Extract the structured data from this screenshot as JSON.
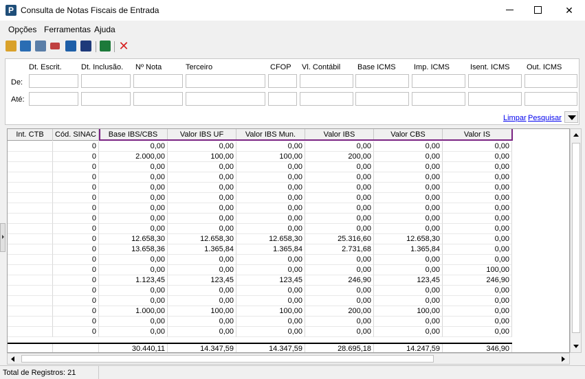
{
  "window": {
    "title": "Consulta de Notas Fiscais de Entrada",
    "app_icon_letter": "P",
    "close_glyph": "✕"
  },
  "menu": [
    "Opções",
    "Ferramentas",
    "Ajuda"
  ],
  "toolbar": {
    "icons": [
      "book-icon",
      "layers-icon",
      "form-icon",
      "eraser-icon",
      "save-icon",
      "chart-icon",
      "excel-icon",
      "close-icon"
    ],
    "colors": {
      "book": "#d9a12a",
      "layers": "#2a6db3",
      "form": "#5a7ea8",
      "eraser": "#c04040",
      "save": "#1e5fa8",
      "chart": "#1e3a7a",
      "excel": "#1d7a3a",
      "close": "#d62020"
    },
    "close_glyph": "✕"
  },
  "filter": {
    "columns": [
      "Dt. Escrit.",
      "Dt. Inclusão.",
      "Nº Nota",
      "Terceiro",
      "CFOP",
      "Vl. Contábil",
      "Base ICMS",
      "Imp. ICMS",
      "Isent. ICMS",
      "Out. ICMS"
    ],
    "row_labels": [
      "De:",
      "Até:"
    ],
    "links": {
      "clear": "Limpar",
      "search": "Pesquisar"
    }
  },
  "grid": {
    "headers": [
      "Int. CTB",
      "Cód. SINAC",
      "Base IBS/CBS",
      "Valor IBS UF",
      "Valor IBS Mun.",
      "Valor IBS",
      "Valor CBS",
      "Valor IS"
    ],
    "rows": [
      [
        "",
        "0",
        "0,00",
        "0,00",
        "0,00",
        "0,00",
        "0,00",
        "0,00"
      ],
      [
        "",
        "0",
        "2.000,00",
        "100,00",
        "100,00",
        "200,00",
        "0,00",
        "0,00"
      ],
      [
        "",
        "0",
        "0,00",
        "0,00",
        "0,00",
        "0,00",
        "0,00",
        "0,00"
      ],
      [
        "",
        "0",
        "0,00",
        "0,00",
        "0,00",
        "0,00",
        "0,00",
        "0,00"
      ],
      [
        "",
        "0",
        "0,00",
        "0,00",
        "0,00",
        "0,00",
        "0,00",
        "0,00"
      ],
      [
        "",
        "0",
        "0,00",
        "0,00",
        "0,00",
        "0,00",
        "0,00",
        "0,00"
      ],
      [
        "",
        "0",
        "0,00",
        "0,00",
        "0,00",
        "0,00",
        "0,00",
        "0,00"
      ],
      [
        "",
        "0",
        "0,00",
        "0,00",
        "0,00",
        "0,00",
        "0,00",
        "0,00"
      ],
      [
        "",
        "0",
        "0,00",
        "0,00",
        "0,00",
        "0,00",
        "0,00",
        "0,00"
      ],
      [
        "",
        "0",
        "12.658,30",
        "12.658,30",
        "12.658,30",
        "25.316,60",
        "12.658,30",
        "0,00"
      ],
      [
        "",
        "0",
        "13.658,36",
        "1.365,84",
        "1.365,84",
        "2.731,68",
        "1.365,84",
        "0,00"
      ],
      [
        "",
        "0",
        "0,00",
        "0,00",
        "0,00",
        "0,00",
        "0,00",
        "0,00"
      ],
      [
        "",
        "0",
        "0,00",
        "0,00",
        "0,00",
        "0,00",
        "0,00",
        "100,00"
      ],
      [
        "",
        "0",
        "1.123,45",
        "123,45",
        "123,45",
        "246,90",
        "123,45",
        "246,90"
      ],
      [
        "",
        "0",
        "0,00",
        "0,00",
        "0,00",
        "0,00",
        "0,00",
        "0,00"
      ],
      [
        "",
        "0",
        "0,00",
        "0,00",
        "0,00",
        "0,00",
        "0,00",
        "0,00"
      ],
      [
        "",
        "0",
        "1.000,00",
        "100,00",
        "100,00",
        "200,00",
        "100,00",
        "0,00"
      ],
      [
        "",
        "0",
        "0,00",
        "0,00",
        "0,00",
        "0,00",
        "0,00",
        "0,00"
      ],
      [
        "",
        "0",
        "0,00",
        "0,00",
        "0,00",
        "0,00",
        "0,00",
        "0,00"
      ]
    ],
    "totals": [
      "",
      "",
      "30.440,11",
      "14.347,59",
      "14.347,59",
      "28.695,18",
      "14.247,59",
      "346,90"
    ],
    "highlight_color": "#7a2382"
  },
  "status": {
    "text": "Total de Registros: 21"
  }
}
